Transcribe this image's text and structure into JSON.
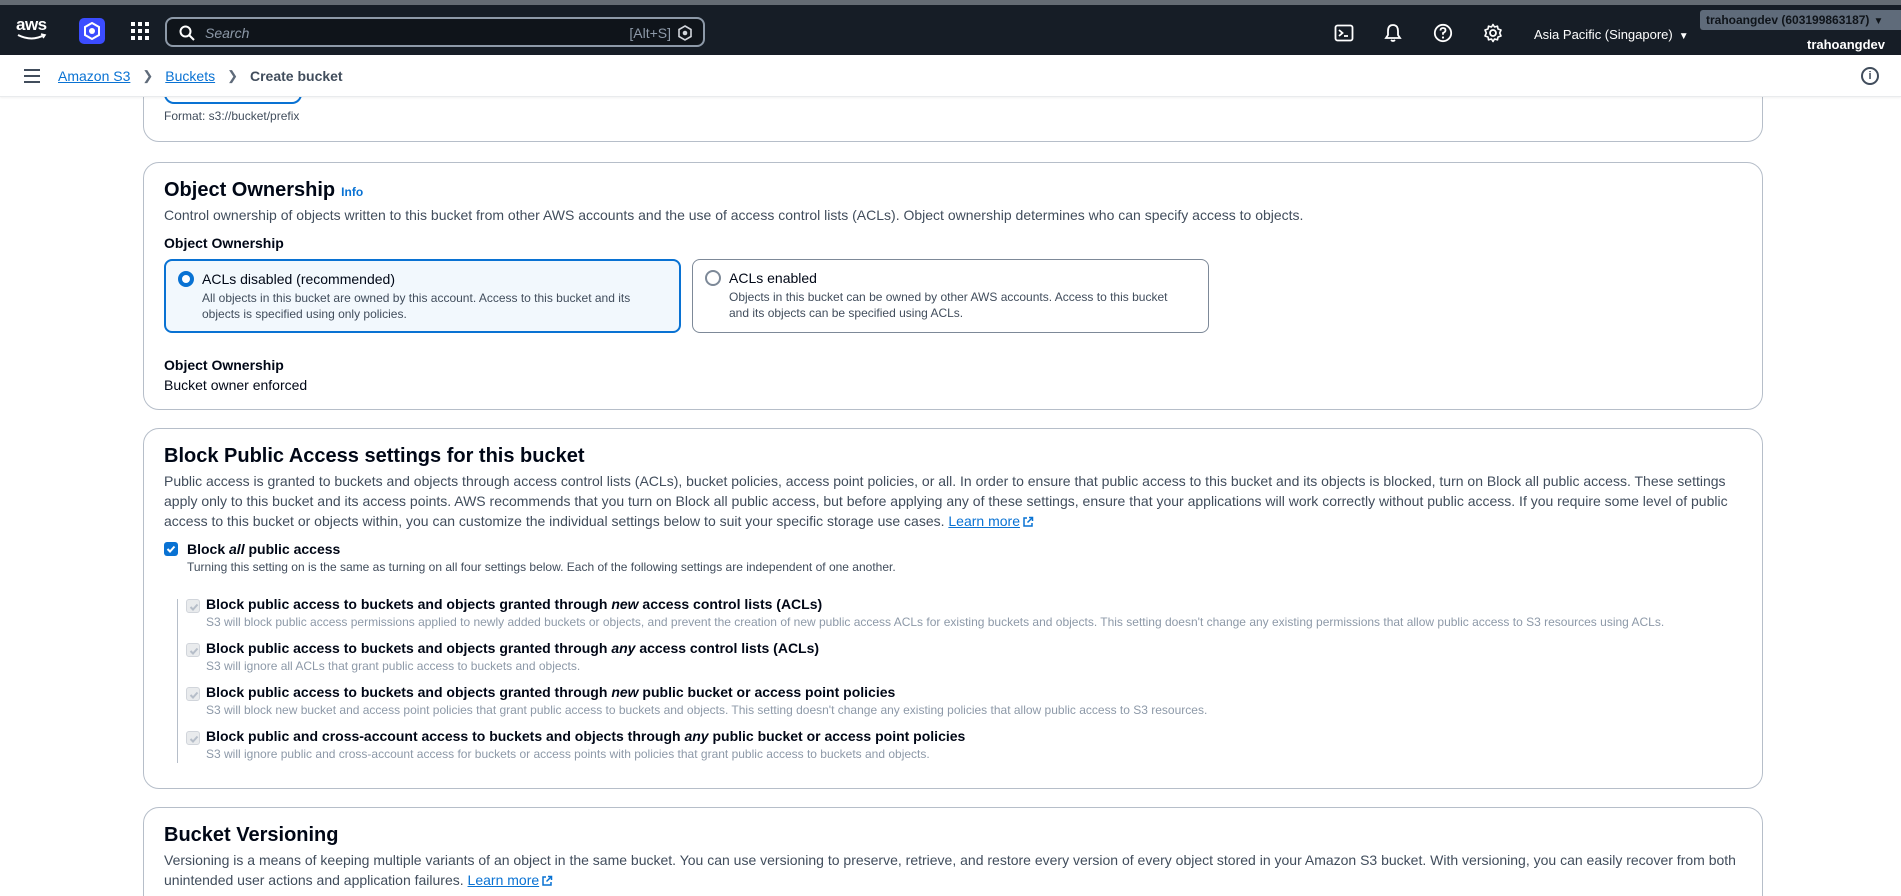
{
  "topbar": {
    "logo_text": "aws",
    "search_placeholder": "Search",
    "search_shortcut": "[Alt+S]",
    "region": "Asia Pacific (Singapore)",
    "account": "trahoangdev (603199863187)",
    "username": "trahoangdev",
    "icons": [
      "cloudshell-icon",
      "bell-icon",
      "help-icon",
      "gear-icon"
    ]
  },
  "breadcrumb": {
    "items": [
      "Amazon S3",
      "Buckets"
    ],
    "current": "Create bucket"
  },
  "prev_section": {
    "format_hint": "Format: s3://bucket/prefix"
  },
  "object_ownership": {
    "title": "Object Ownership",
    "info": "Info",
    "description": "Control ownership of objects written to this bucket from other AWS accounts and the use of access control lists (ACLs). Object ownership determines who can specify access to objects.",
    "field_label": "Object Ownership",
    "options": [
      {
        "title": "ACLs disabled (recommended)",
        "description": "All objects in this bucket are owned by this account. Access to this bucket and its objects is specified using only policies.",
        "selected": true
      },
      {
        "title": "ACLs enabled",
        "description": "Objects in this bucket can be owned by other AWS accounts. Access to this bucket and its objects can be specified using ACLs.",
        "selected": false
      }
    ],
    "result_label": "Object Ownership",
    "result_value": "Bucket owner enforced"
  },
  "block_public_access": {
    "title": "Block Public Access settings for this bucket",
    "description": "Public access is granted to buckets and objects through access control lists (ACLs), bucket policies, access point policies, or all. In order to ensure that public access to this bucket and its objects is blocked, turn on Block all public access. These settings apply only to this bucket and its access points. AWS recommends that you turn on Block all public access, but before applying any of these settings, ensure that your applications will work correctly without public access. If you require some level of public access to this bucket or objects within, you can customize the individual settings below to suit your specific storage use cases.",
    "learn_more": "Learn more",
    "block_all": {
      "label_pre": "Block ",
      "label_em": "all",
      "label_post": " public access",
      "description": "Turning this setting on is the same as turning on all four settings below. Each of the following settings are independent of one another.",
      "checked": true
    },
    "settings": [
      {
        "pre": "Block public access to buckets and objects granted through ",
        "em": "new",
        "post": " access control lists (ACLs)",
        "description": "S3 will block public access permissions applied to newly added buckets or objects, and prevent the creation of new public access ACLs for existing buckets and objects. This setting doesn't change any existing permissions that allow public access to S3 resources using ACLs."
      },
      {
        "pre": "Block public access to buckets and objects granted through ",
        "em": "any",
        "post": " access control lists (ACLs)",
        "description": "S3 will ignore all ACLs that grant public access to buckets and objects."
      },
      {
        "pre": "Block public access to buckets and objects granted through ",
        "em": "new",
        "post": " public bucket or access point policies",
        "description": "S3 will block new bucket and access point policies that grant public access to buckets and objects. This setting doesn't change any existing policies that allow public access to S3 resources."
      },
      {
        "pre": "Block public and cross-account access to buckets and objects through ",
        "em": "any",
        "post": " public bucket or access point policies",
        "description": "S3 will ignore public and cross-account access for buckets or access points with policies that grant public access to buckets and objects."
      }
    ]
  },
  "versioning": {
    "title": "Bucket Versioning",
    "description": "Versioning is a means of keeping multiple variants of an object in the same bucket. You can use versioning to preserve, retrieve, and restore every version of every object stored in your Amazon S3 bucket. With versioning, you can easily recover from both unintended user actions and application failures.",
    "learn_more": "Learn more"
  }
}
